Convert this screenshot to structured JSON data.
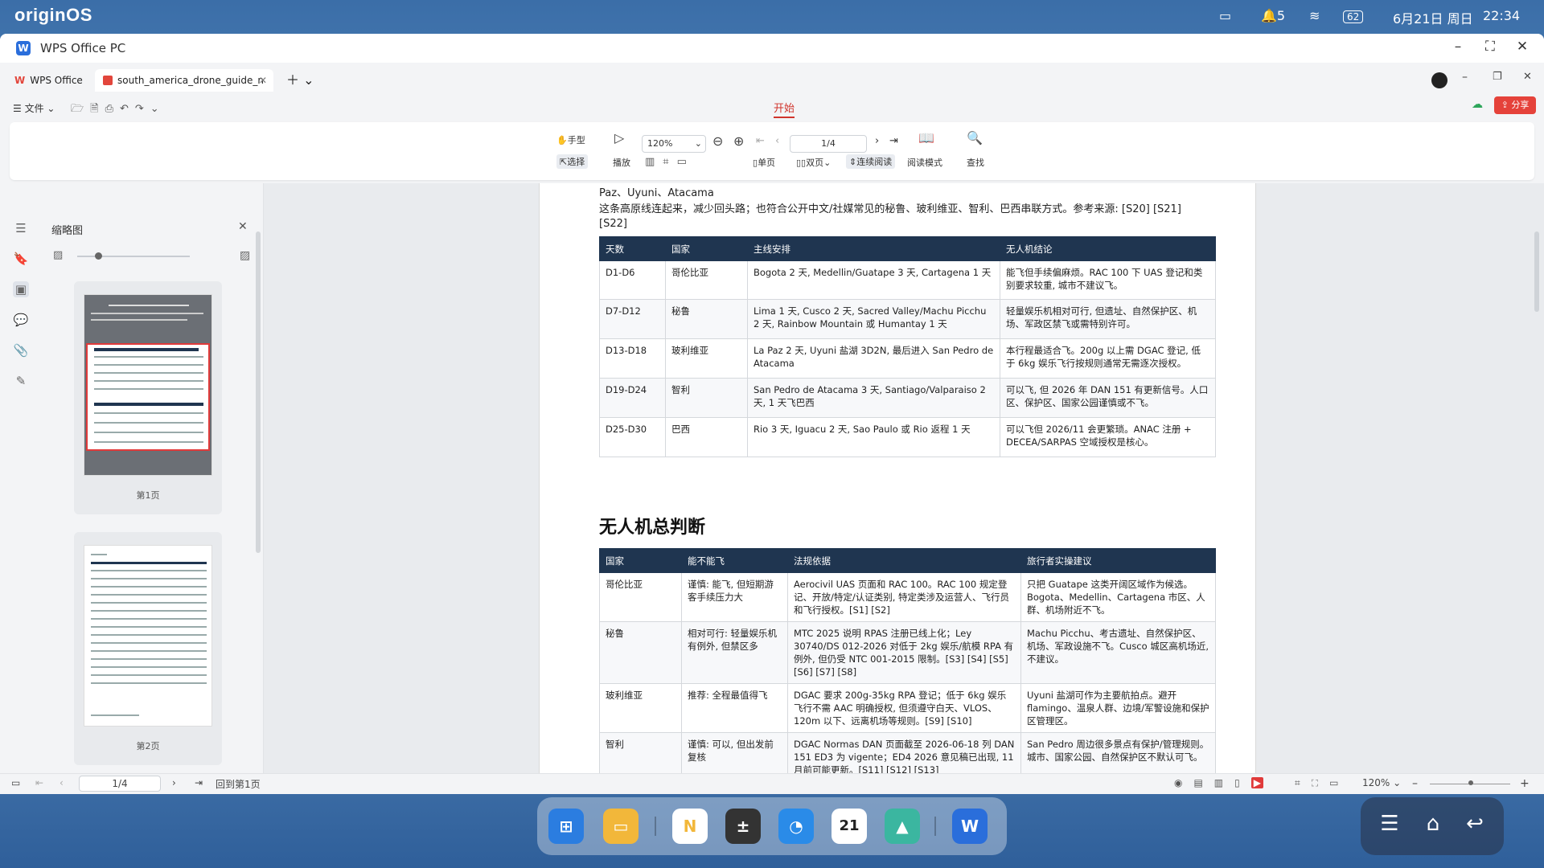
{
  "status_bar": {
    "os_logo": "originOS",
    "notifications": "5",
    "battery": "62",
    "date": "6月21日 周日",
    "time": "22:34"
  },
  "window": {
    "title": "WPS Office PC"
  },
  "tabs": [
    {
      "label": "WPS Office"
    },
    {
      "label": "south_america_drone_guide_n"
    }
  ],
  "menu": {
    "file": "文件",
    "active_ribbon": "开始",
    "share": "分享"
  },
  "toolbar": {
    "hand": "手型",
    "select": "选择",
    "play": "播放",
    "zoom": "120%",
    "page": "1/4",
    "single": "单页",
    "double": "双页",
    "continuous": "连续阅读",
    "read_mode": "阅读模式",
    "find": "查找"
  },
  "thumbnail_panel": {
    "title": "缩略图",
    "pages": [
      "第1页",
      "第2页"
    ]
  },
  "document": {
    "line1": "Paz、Uyuni、Atacama",
    "line2": "这条高原线连起来，减少回头路；也符合公开中文/社媒常见的秘鲁、玻利维亚、智利、巴西串联方式。参考来源: [S20] [S21] [S22]",
    "table1": {
      "headers": [
        "天数",
        "国家",
        "主线安排",
        "无人机结论"
      ],
      "rows": [
        [
          "D1-D6",
          "哥伦比亚",
          "Bogota 2 天, Medellin/Guatape 3 天, Cartagena 1 天",
          "能飞但手续偏麻烦。RAC 100 下 UAS 登记和类别要求较重, 城市不建议飞。"
        ],
        [
          "D7-D12",
          "秘鲁",
          "Lima 1 天, Cusco 2 天, Sacred Valley/Machu Picchu 2 天, Rainbow Mountain 或 Humantay 1 天",
          "轻量娱乐机相对可行, 但遗址、自然保护区、机场、军政区禁飞或需特别许可。"
        ],
        [
          "D13-D18",
          "玻利维亚",
          "La Paz 2 天, Uyuni 盐湖 3D2N, 最后进入 San Pedro de Atacama",
          "本行程最适合飞。200g 以上需 DGAC 登记, 低于 6kg 娱乐飞行按规则通常无需逐次授权。"
        ],
        [
          "D19-D24",
          "智利",
          "San Pedro de Atacama 3 天, Santiago/Valparaiso 2 天, 1 天飞巴西",
          "可以飞, 但 2026 年 DAN 151 有更新信号。人口区、保护区、国家公园谨慎或不飞。"
        ],
        [
          "D25-D30",
          "巴西",
          "Rio 3 天, Iguacu 2 天, Sao Paulo 或 Rio 返程 1 天",
          "可以飞但 2026/11 会更繁琐。ANAC 注册 + DECEA/SARPAS 空域授权是核心。"
        ]
      ]
    },
    "heading": "无人机总判断",
    "table2": {
      "headers": [
        "国家",
        "能不能飞",
        "法规依据",
        "旅行者实操建议"
      ],
      "rows": [
        [
          "哥伦比亚",
          "谨慎: 能飞, 但短期游客手续压力大",
          "Aerocivil UAS 页面和 RAC 100。RAC 100 规定登记、开放/特定/认证类别, 特定类涉及运营人、飞行员和飞行授权。[S1] [S2]",
          "只把 Guatape 这类开阔区域作为候选。Bogota、Medellin、Cartagena 市区、人群、机场附近不飞。"
        ],
        [
          "秘鲁",
          "相对可行: 轻量娱乐机有例外, 但禁区多",
          "MTC 2025 说明 RPAS 注册已线上化；Ley 30740/DS 012-2026 对低于 2kg 娱乐/航模 RPA 有例外, 但仍受 NTC 001-2015 限制。[S3] [S4] [S5] [S6] [S7] [S8]",
          "Machu Picchu、考古遗址、自然保护区、机场、军政设施不飞。Cusco 城区高机场近, 不建议。"
        ],
        [
          "玻利维亚",
          "推荐: 全程最值得飞",
          "DGAC 要求 200g-35kg RPA 登记；低于 6kg 娱乐飞行不需 AAC 明确授权, 但须遵守白天、VLOS、120m 以下、远离机场等规则。[S9] [S10]",
          "Uyuni 盐湖可作为主要航拍点。避开 flamingo、温泉人群、边境/军警设施和保护区管理区。"
        ],
        [
          "智利",
          "谨慎: 可以, 但出发前复核",
          "DGAC Normas DAN 页面截至 2026-06-18 列 DAN 151 ED3 为 vigente；ED4 2026 意见稿已出现, 11 月前可能更新。[S11] [S12] [S13]",
          "San Pedro 周边很多景点有保护/管理规则。城市、国家公园、自然保护区不默认可飞。"
        ]
      ]
    }
  },
  "bottom_bar": {
    "page": "1/4",
    "back": "回到第1页",
    "zoom": "120%"
  },
  "dock": {
    "calendar_day": "21"
  }
}
